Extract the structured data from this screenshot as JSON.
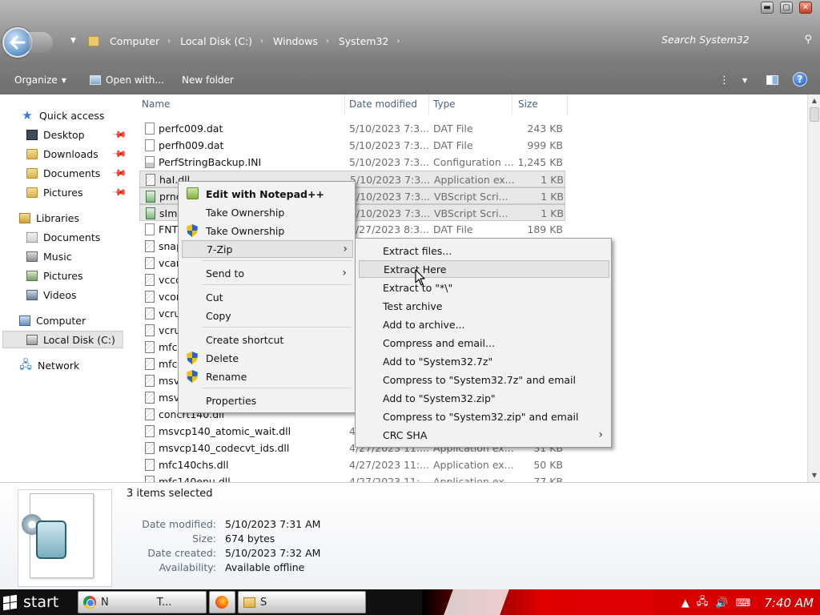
{
  "window": {
    "controls": {
      "minimize": "▬",
      "maximize": "▢",
      "close": "✕"
    }
  },
  "breadcrumb": {
    "items": [
      "Computer",
      "Local Disk (C:)",
      "Windows",
      "System32"
    ],
    "separator": "›"
  },
  "search": {
    "placeholder": "Search System32"
  },
  "toolbar": {
    "organize": "Organize",
    "open_with": "Open with...",
    "new_folder": "New folder"
  },
  "nav": {
    "quick_access": "Quick access",
    "desktop": "Desktop",
    "downloads": "Downloads",
    "documents": "Documents",
    "pictures": "Pictures",
    "libraries": "Libraries",
    "lib_documents": "Documents",
    "music": "Music",
    "lib_pictures": "Pictures",
    "videos": "Videos",
    "computer": "Computer",
    "local_disk": "Local Disk (C:)",
    "network": "Network"
  },
  "columns": {
    "name": "Name",
    "date": "Date modified",
    "type": "Type",
    "size": "Size"
  },
  "files": [
    {
      "name": "perfc009.dat",
      "date": "5/10/2023 7:3...",
      "type": "DAT File",
      "size": "243 KB",
      "icon": "dat"
    },
    {
      "name": "perfh009.dat",
      "date": "5/10/2023 7:3...",
      "type": "DAT File",
      "size": "999 KB",
      "icon": "dat"
    },
    {
      "name": "PerfStringBackup.INI",
      "date": "5/10/2023 7:3...",
      "type": "Configuration ...",
      "size": "1,245 KB",
      "icon": "ini"
    },
    {
      "name": "haI.dll",
      "date": "5/10/2023 7:3...",
      "type": "Application ex...",
      "size": "1 KB",
      "icon": "dll",
      "selected": true
    },
    {
      "name": "prnq",
      "date": "5/10/2023 7:3...",
      "type": "VBScript Scri...",
      "size": "1 KB",
      "icon": "vbs",
      "selected": true
    },
    {
      "name": "sImg",
      "date": "5/10/2023 7:3...",
      "type": "VBScript Scri...",
      "size": "1 KB",
      "icon": "vbs",
      "selected": true
    },
    {
      "name": "FNT",
      "date": "4/27/2023 8:3...",
      "type": "DAT File",
      "size": "189 KB",
      "icon": "dat"
    },
    {
      "name": "snap",
      "date": "",
      "type": "",
      "size": "",
      "icon": "dll"
    },
    {
      "name": "vcam",
      "date": "",
      "type": "",
      "size": "",
      "icon": "dll"
    },
    {
      "name": "vcco",
      "date": "",
      "type": "",
      "size": "",
      "icon": "dll"
    },
    {
      "name": "vcom",
      "date": "",
      "type": "",
      "size": "",
      "icon": "dll"
    },
    {
      "name": "vcru",
      "date": "",
      "type": "",
      "size": "",
      "icon": "dll"
    },
    {
      "name": "vcru",
      "date": "",
      "type": "",
      "size": "",
      "icon": "dll"
    },
    {
      "name": "mfc1",
      "date": "",
      "type": "",
      "size": "",
      "icon": "dll"
    },
    {
      "name": "mfc1",
      "date": "",
      "type": "",
      "size": "",
      "icon": "dll"
    },
    {
      "name": "msvc",
      "date": "",
      "type": "",
      "size": "",
      "icon": "dll"
    },
    {
      "name": "msvc",
      "date": "",
      "type": "",
      "size": "",
      "icon": "dll"
    },
    {
      "name": "concrt140.dll",
      "date": "",
      "type": "",
      "size": "",
      "icon": "dll"
    },
    {
      "name": "msvcp140_atomic_wait.dll",
      "date": "4",
      "type": "",
      "size": "",
      "icon": "dll"
    },
    {
      "name": "msvcp140_codecvt_ids.dll",
      "date": "4/27/2023 11:...",
      "type": "Application ex...",
      "size": "31 KB",
      "icon": "dll"
    },
    {
      "name": "mfc140chs.dll",
      "date": "4/27/2023 11:...",
      "type": "Application ex...",
      "size": "50 KB",
      "icon": "dll"
    },
    {
      "name": "mfc140enu.dll",
      "date": "4/27/2023 11:...",
      "type": "Application ex...",
      "size": "77 KB",
      "icon": "dll"
    }
  ],
  "context_menu": {
    "items": [
      {
        "label": "Edit with Notepad++",
        "icon": "notepadpp-icon",
        "bold": true
      },
      {
        "label": "Take Ownership",
        "icon": ""
      },
      {
        "label": "Take Ownership",
        "icon": "shield-icon"
      },
      {
        "label": "7-Zip",
        "icon": "",
        "submenu": true,
        "highlighted": true
      },
      {
        "label": "Send to",
        "icon": "",
        "submenu": true
      },
      {
        "label": "Cut",
        "icon": ""
      },
      {
        "label": "Copy",
        "icon": ""
      },
      {
        "label": "Create shortcut",
        "icon": ""
      },
      {
        "label": "Delete",
        "icon": "shield-icon"
      },
      {
        "label": "Rename",
        "icon": "shield-icon"
      },
      {
        "label": "Properties",
        "icon": ""
      }
    ]
  },
  "zip_menu": {
    "items": [
      "Extract files...",
      "Extract Here",
      "Extract to \"*\\\"",
      "Test archive",
      "Add to archive...",
      "Compress and email...",
      "Add to \"System32.7z\"",
      "Compress to \"System32.7z\" and email",
      "Add to \"System32.zip\"",
      "Compress to \"System32.zip\" and email",
      "CRC SHA"
    ],
    "highlighted": "Extract Here"
  },
  "details": {
    "selection": "3 items selected",
    "date_modified_label": "Date modified:",
    "date_modified": "5/10/2023 7:31 AM",
    "size_label": "Size:",
    "size": "674 bytes",
    "date_created_label": "Date created:",
    "date_created": "5/10/2023 7:32 AM",
    "availability_label": "Availability:",
    "availability": "Available offline"
  },
  "taskbar": {
    "start": "start",
    "chrome_label": "N",
    "chrome_label2": "T...",
    "explorer_label": "S",
    "clock": "7:40 AM"
  }
}
